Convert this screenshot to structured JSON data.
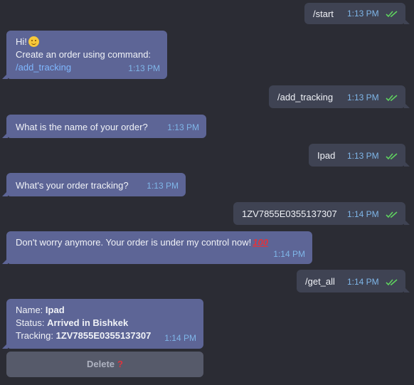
{
  "messages": [
    {
      "dir": "out",
      "text": "/start",
      "time": "1:13 PM"
    },
    {
      "dir": "in",
      "greeting": "Hi!",
      "greeting_emoji": "smile-emoji-icon",
      "line2": "Create an order using command:",
      "command": "/add_tracking",
      "time": "1:13 PM"
    },
    {
      "dir": "out",
      "text": "/add_tracking",
      "time": "1:13 PM"
    },
    {
      "dir": "in",
      "text": "What is the name of your order?",
      "time": "1:13 PM"
    },
    {
      "dir": "out",
      "text": "Ipad",
      "time": "1:13 PM"
    },
    {
      "dir": "in",
      "text": "What's your order tracking?",
      "time": "1:13 PM"
    },
    {
      "dir": "out",
      "text": "1ZV7855E0355137307",
      "time": "1:14 PM"
    },
    {
      "dir": "in",
      "text": "Don't worry anymore. Your order is under my control now!",
      "emoji": "hundred-points-icon",
      "emoji_text": "100",
      "time": "1:14 PM"
    },
    {
      "dir": "out",
      "text": "/get_all",
      "time": "1:14 PM"
    },
    {
      "dir": "in",
      "name_label": "Name: ",
      "name_value": "Ipad",
      "status_label": "Status: ",
      "status_value": "Arrived in Bishkek",
      "tracking_label": "Tracking: ",
      "tracking_value": "1ZV7855E0355137307",
      "time": "1:14 PM"
    }
  ],
  "inline_button": {
    "label": "Delete",
    "icon": "question-mark-icon",
    "icon_text": "?"
  },
  "colors": {
    "background": "#2b2c34",
    "outgoing_bubble": "#3f4353",
    "incoming_bubble": "#5d6596",
    "link": "#7fb8ff",
    "time": "#7fb6e8",
    "read_check": "#5fd35f"
  }
}
